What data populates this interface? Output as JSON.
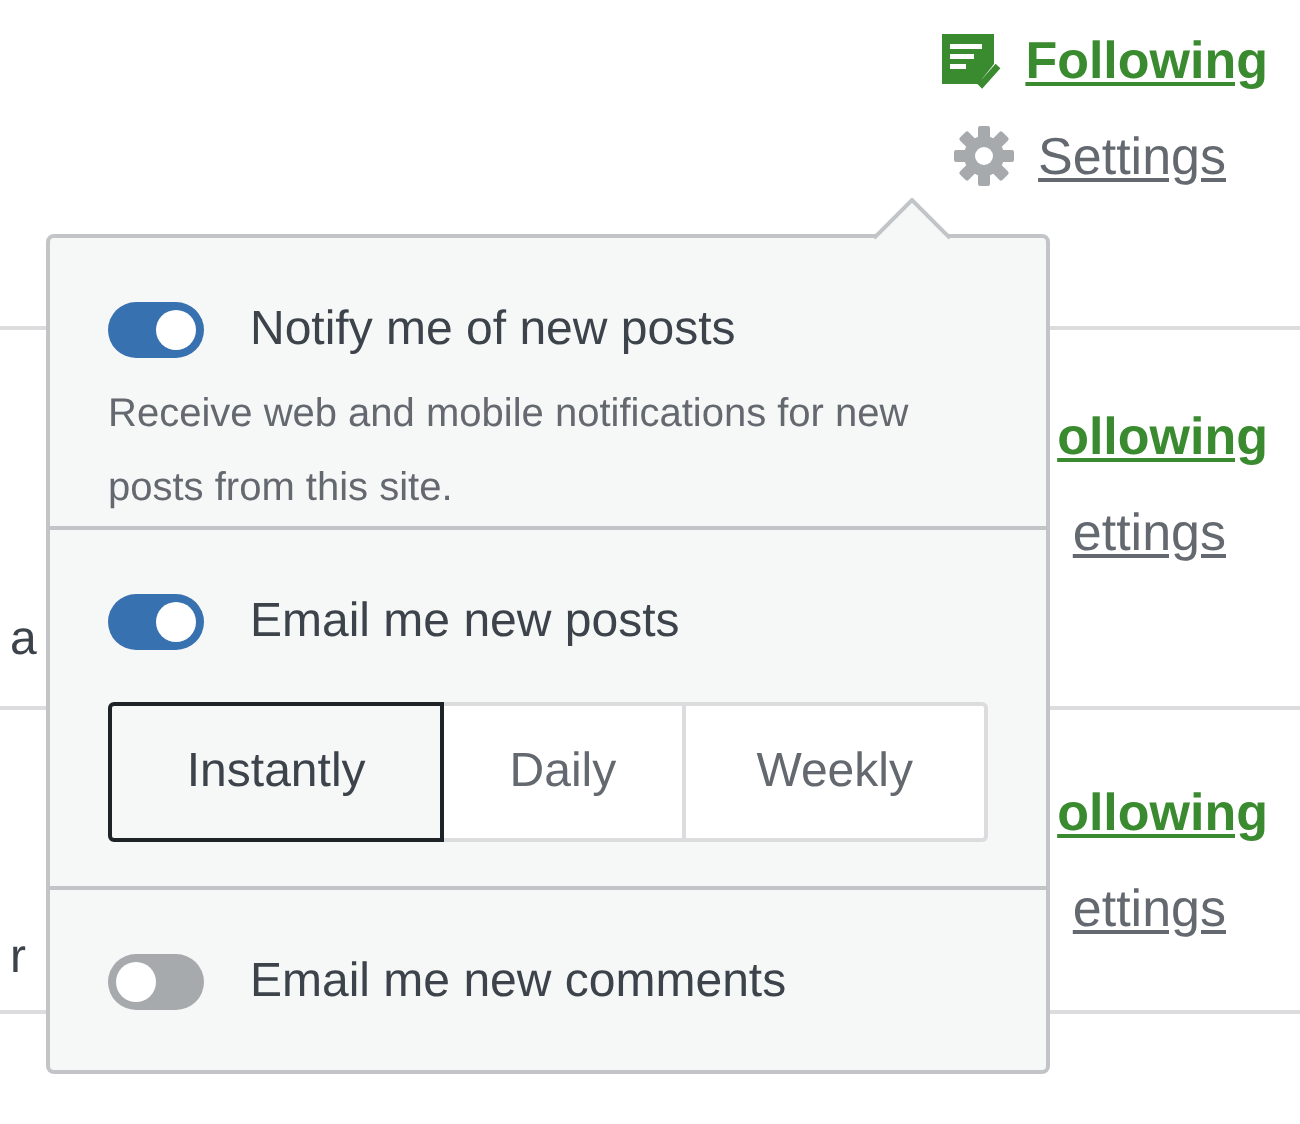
{
  "rows": [
    {
      "fragment": null,
      "following": {
        "label": "Following",
        "icon": true
      },
      "settings": {
        "label": "Settings",
        "icon": true
      }
    },
    {
      "fragment": "a",
      "following": {
        "label": "ollowing",
        "icon": false
      },
      "settings": {
        "label": "ettings",
        "icon": false
      }
    },
    {
      "fragment": "r",
      "following": {
        "label": "ollowing",
        "icon": false
      },
      "settings": {
        "label": "ettings",
        "icon": false
      }
    }
  ],
  "settings_popover": {
    "options": [
      {
        "label": "Notify me of new posts",
        "on": true,
        "description": "Receive web and mobile notifications for new posts from this site."
      },
      {
        "label": "Email me new posts",
        "on": true,
        "frequency": [
          {
            "label": "Instantly",
            "selected": true
          },
          {
            "label": "Daily",
            "selected": false
          },
          {
            "label": "Weekly",
            "selected": false
          }
        ]
      },
      {
        "label": "Email me new comments",
        "on": false
      }
    ]
  }
}
